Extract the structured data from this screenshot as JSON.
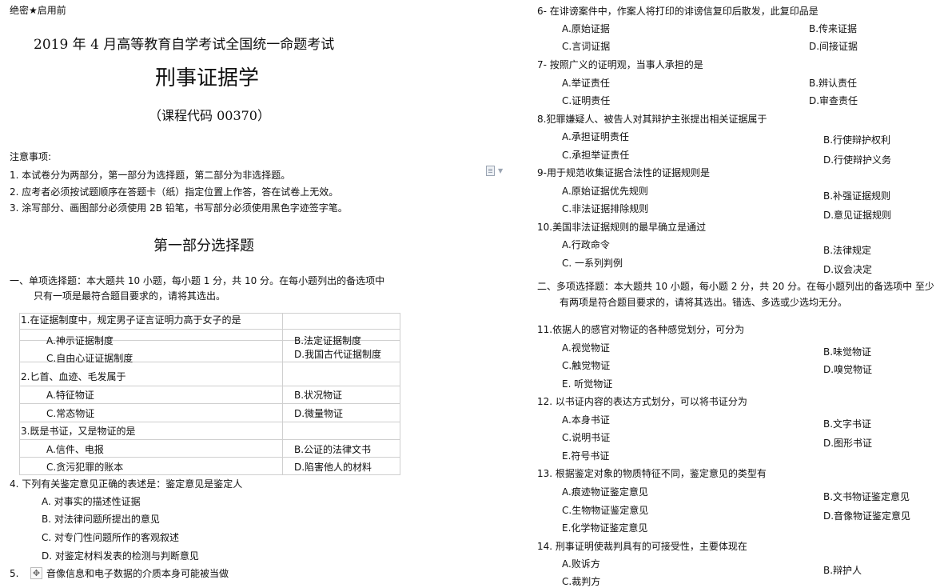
{
  "header": {
    "secret": "绝密★启用前",
    "exam_title": "2019 年 4 月高等教育自学考试全国统一命题考试",
    "subject": "刑事证据学",
    "course_code": "（课程代码 00370）"
  },
  "notes": {
    "heading": "注意事项:",
    "items": [
      "1.   本试卷分为两部分，第一部分为选择题，第二部分为非选择题。",
      "2.   应考者必须按试题顺序在答题卡（纸）指定位置上作答，答在试卷上无效。",
      "3.   涂写部分、画图部分必须使用 2B 铅笔，书写部分必须使用黑色字迹签字笔。"
    ]
  },
  "part1_title": "第一部分选择题",
  "section1": {
    "line1": "一、单项选择题：本大题共 10 小题，每小题 1 分，共 10 分。在每小题列出的备选项中",
    "line2": "只有一项是最符合题目要求的，请将其选出。"
  },
  "q1": {
    "stem": "1.在证据制度中，规定男子证言证明力高于女子的是",
    "a": "A.神示证据制度",
    "b": "B.法定证据制度",
    "c": "C.自由心证证据制度",
    "d": "D.我国古代证据制度"
  },
  "q2": {
    "stem": "2.匕首、血迹、毛发属于",
    "a": "A.特征物证",
    "b": "B.状况物证",
    "c": "C.常态物证",
    "d": "D.微量物证"
  },
  "q3": {
    "stem": "3.既是书证，又是物证的是",
    "a": "A.信件、电报",
    "b": "B.公证的法律文书",
    "c": "C.贪污犯罪的账本",
    "d": "D.陷害他人的材料"
  },
  "q4": {
    "stem": "4.    下列有关鉴定意见正确的表述是：鉴定意见是鉴定人",
    "a": "A.    对事实的描述性证据",
    "b": "B.    对法律问题所提出的意见",
    "c": "C.    对专门性问题所作的客观叙述",
    "d": "D.    对鉴定材料发表的检测与判断意见"
  },
  "q5": {
    "num": "5.",
    "stem": "音像信息和电子数据的介质本身可能被当做"
  },
  "q6": {
    "stem": "6-    在诽谤案件中，作案人将打印的诽谤信复印后散发，此复印品是",
    "a": "A.原始证据",
    "b": "B.传来证据",
    "c": "C.言词证据",
    "d": "D.间接证据"
  },
  "q7": {
    "stem": "7-    按照广义的证明观，当事人承担的是",
    "a": "A.举证责任",
    "b": "B.辨认责任",
    "c": "C.证明责任",
    "d": "D.审查责任"
  },
  "q8": {
    "stem": "8.犯罪嫌疑人、被告人对其辩护主张提出相关证据属于",
    "a": "A.承担证明责任",
    "b": "B.行使辩护权利",
    "c": "C.承担举证责任",
    "d": "D.行使辩护义务"
  },
  "q9": {
    "stem": "9-用于规范收集证据合法性的证据规则是",
    "a": "A.原始证据优先规则",
    "b": "B.补强证据规则",
    "c": "C.非法证据排除规则",
    "d": "D.意见证据规则"
  },
  "q10": {
    "stem": "10.美国非法证据规则的最早确立是通过",
    "a": "A.行政命令",
    "b": "B.法律规定",
    "c": "C. 一系列判例",
    "d": "D.议会决定"
  },
  "section2": {
    "line1": "二、多项选择题：本大题共 10 小题，每小题 2 分，共 20 分。在每小题列出的备选项中 至少",
    "line2": "有两项是符合题目要求的，请将其选出。错选、多选或少选均无分。"
  },
  "q11": {
    "stem": "11.依据人的感官对物证的各种感觉划分，可分为",
    "a": "A.视觉物证",
    "b": "B.味觉物证",
    "c": "C.触觉物证",
    "d": "D.嗅觉物证",
    "e": "E.    听觉物证"
  },
  "q12": {
    "stem": "12.   以书证内容的表达方式划分，可以将书证分为",
    "a": "A.本身书证",
    "b": "B.文字书证",
    "c": "C.说明书证",
    "d": "D.图形书证",
    "e": "E.符号书证"
  },
  "q13": {
    "stem": "13.   根据鉴定对象的物质特征不同，鉴定意见的类型有",
    "a": "A.痕迹物证鉴定意见",
    "b": "B.文书物证鉴定意见",
    "c": "C.生物物证鉴定意见",
    "d": "D.音像物证鉴定意见",
    "e": "E.化学物证鉴定意见"
  },
  "q14": {
    "stem": "14.   刑事证明使裁判具有的可接受性，主要体现在",
    "a": "A.败诉方",
    "b": "B.辩护人",
    "c": "C.裁判方"
  }
}
